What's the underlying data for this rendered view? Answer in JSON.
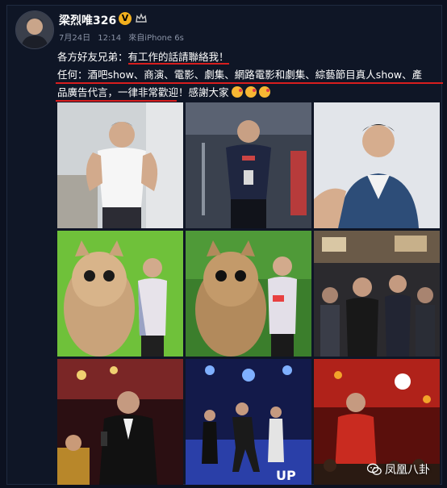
{
  "post": {
    "username": "梁烈唯326",
    "verified_badge": "V",
    "meta": {
      "date": "7月24日",
      "time": "12:14",
      "source": "來自iPhone 6s"
    },
    "lines": {
      "line1_prefix": "各方好友兄弟：",
      "line1_highlight": "有工作的話請聯絡我！",
      "line2": "任何：酒吧show、商演、電影、劇集、網路電影和劇集、綜藝節目真人show、產",
      "line3": "品廣告代言，一律非常歡迎！感謝大家"
    },
    "emoji_icon": "kiss-face-emoji",
    "photos": [
      {
        "name": "photo-white-vest",
        "colors": [
          "#cfd3d6",
          "#ffffff"
        ]
      },
      {
        "name": "photo-gym-selfie",
        "colors": [
          "#2b3340",
          "#5b6270"
        ]
      },
      {
        "name": "photo-denim-vest",
        "colors": [
          "#dfe3ea",
          "#2d4d78"
        ]
      },
      {
        "name": "photo-green-screen-cat",
        "colors": [
          "#6fc13a",
          "#c9a37a"
        ]
      },
      {
        "name": "photo-cat-mascot",
        "colors": [
          "#b28a5c",
          "#3b7e2c"
        ]
      },
      {
        "name": "photo-crowd-event",
        "colors": [
          "#5a4f45",
          "#1d1d22"
        ]
      },
      {
        "name": "photo-suit-microphone",
        "colors": [
          "#8a2a2a",
          "#111111"
        ]
      },
      {
        "name": "photo-stage-dance",
        "colors": [
          "#1a2a7a",
          "#3a6fe0"
        ]
      },
      {
        "name": "photo-concert-stage",
        "colors": [
          "#b0221a",
          "#f3a42a"
        ]
      }
    ],
    "watermark": {
      "icon": "wechat-icon",
      "text": "凤凰八卦"
    },
    "accent_color": "#d81e1e"
  }
}
